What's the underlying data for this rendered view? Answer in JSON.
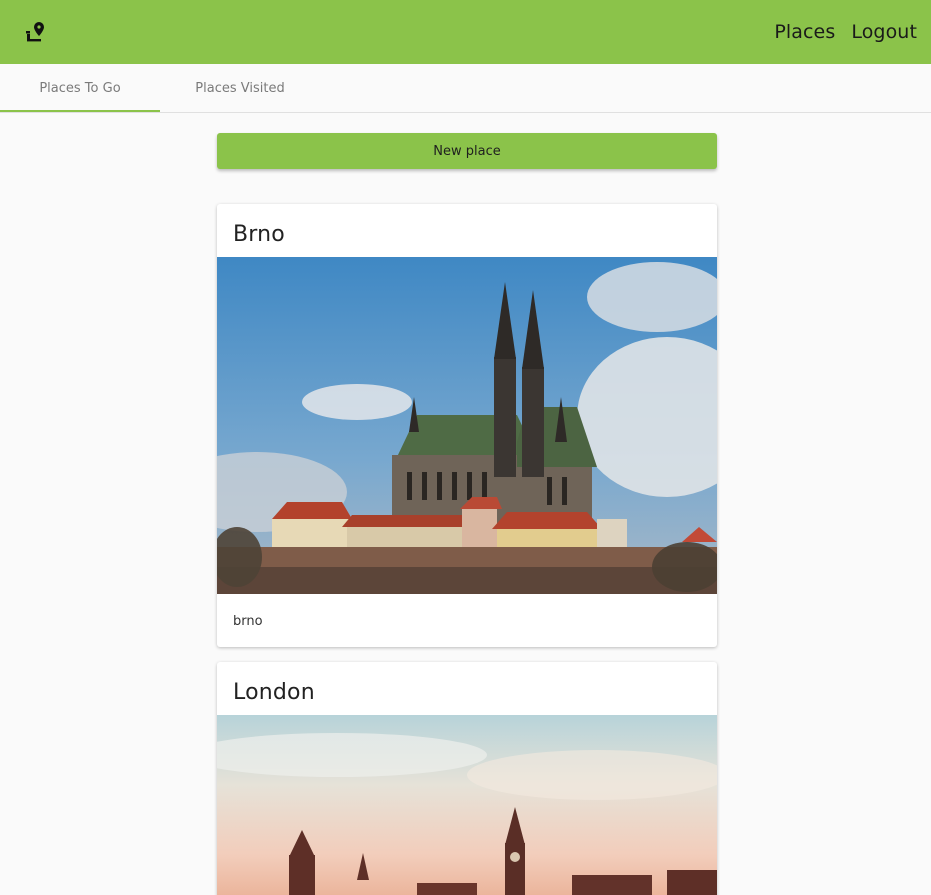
{
  "app": {
    "logo_icon": "location-person-icon",
    "accent_color": "#8bc34a"
  },
  "toolbar": {
    "nav": [
      {
        "label": "Places"
      },
      {
        "label": "Logout"
      }
    ]
  },
  "tabs": [
    {
      "label": "Places To Go",
      "active": true
    },
    {
      "label": "Places Visited",
      "active": false
    }
  ],
  "actions": {
    "new_place_label": "New place"
  },
  "places": [
    {
      "title": "Brno",
      "description": "brno",
      "image": "cathedral-on-hill-photo"
    },
    {
      "title": "London",
      "description": "",
      "image": "parliament-big-ben-photo"
    }
  ]
}
